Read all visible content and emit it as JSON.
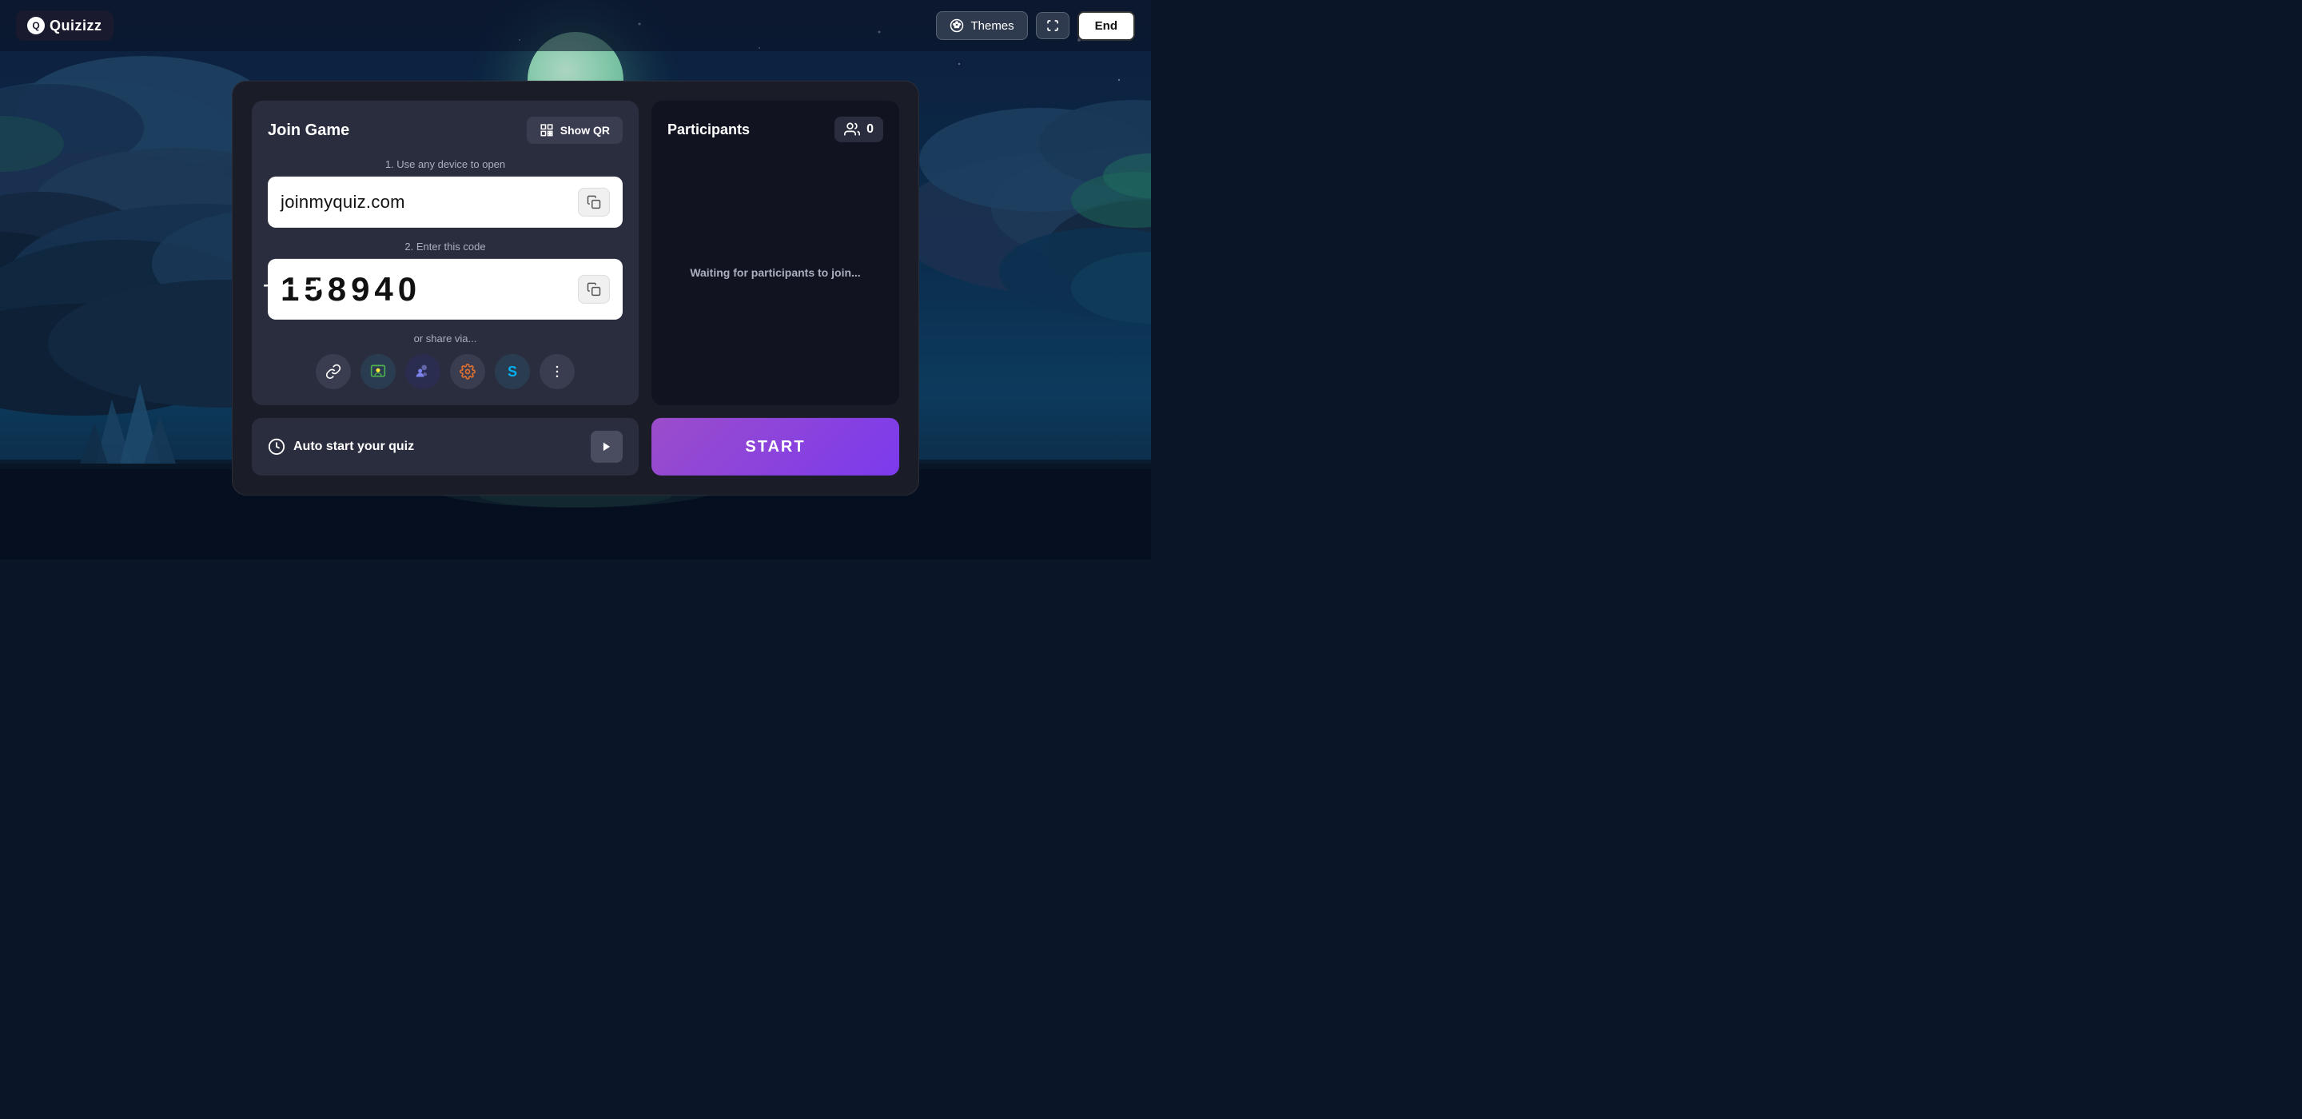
{
  "app": {
    "logo_text": "Quizizz",
    "logo_initial": "Q"
  },
  "navbar": {
    "themes_label": "Themes",
    "end_label": "End"
  },
  "join_panel": {
    "title": "Join Game",
    "show_qr_label": "Show QR",
    "step1_label": "1. Use any device to open",
    "url_value": "joinmyquiz.com",
    "step2_label": "2. Enter this code",
    "code_value": "158940",
    "share_label": "or share via..."
  },
  "participants_panel": {
    "title": "Participants",
    "count": "0",
    "waiting_text": "Waiting for participants to join..."
  },
  "bottom_bar": {
    "auto_start_label": "Auto start your quiz",
    "start_label": "START"
  },
  "share_icons": [
    {
      "name": "link-icon",
      "symbol": "🔗"
    },
    {
      "name": "classroom-icon",
      "symbol": "📋"
    },
    {
      "name": "teams-icon",
      "symbol": "👥"
    },
    {
      "name": "settings-icon",
      "symbol": "⚙"
    },
    {
      "name": "skype-icon",
      "symbol": "S"
    },
    {
      "name": "more-icon",
      "symbol": "⋮"
    }
  ]
}
